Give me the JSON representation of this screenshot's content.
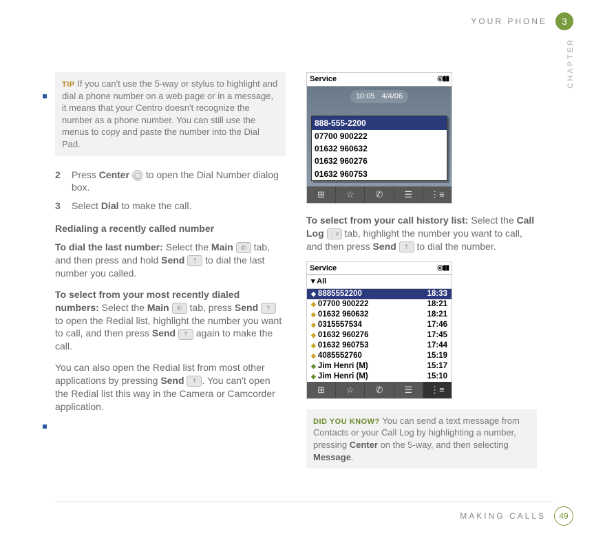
{
  "header": {
    "title": "YOUR PHONE",
    "chapter_num": "3",
    "chapter_label": "CHAPTER"
  },
  "footer": {
    "title": "MAKING CALLS",
    "page_num": "49"
  },
  "left": {
    "tip_label": "TIP",
    "tip_text": "If you can't use the 5-way or stylus to highlight and dial a phone number on a web page or in a message, it means that your Centro doesn't recognize the number as a phone number. You can still use the menus to copy and paste the number into the Dial Pad.",
    "step2_num": "2",
    "step2_a": "Press ",
    "step2_b": "Center",
    "step2_c": " to open the Dial Number dialog box.",
    "step3_num": "3",
    "step3_a": "Select ",
    "step3_b": "Dial",
    "step3_c": " to make the call.",
    "subhead_redial": "Redialing a recently called number",
    "last_a": "To dial the last number:",
    "last_b": " Select the ",
    "last_c": "Main",
    "last_d": " tab, and then press and hold ",
    "last_e": "Send",
    "last_f": " to dial the last number you called.",
    "recent_a": "To select from your most recently dialed numbers:",
    "recent_b": " Select the ",
    "recent_c": "Main",
    "recent_d": " tab, press ",
    "recent_e": "Send",
    "recent_f": " to open the Redial list, highlight the number you want to call, and then press ",
    "recent_g": "Send",
    "recent_h": " again to make the call.",
    "note_a": "You can also open the Redial list from most other applications by pressing ",
    "note_b": "Send",
    "note_c": ". You can't open the Redial list this way in the Camera or Camcorder application."
  },
  "right": {
    "shot1": {
      "service": "Service",
      "signal": "◎▮▮",
      "time": "10:05",
      "date": "4/4/06",
      "hl": "888-555-2200",
      "rows": [
        "07700 900222",
        "01632 960632",
        "01632 960276",
        "01632 960753"
      ],
      "tabs": [
        "⊞",
        "☆",
        "✆",
        "☰",
        "⋮≡"
      ]
    },
    "hist_a": "To select from your call history list:",
    "hist_b": " Select the ",
    "hist_c": "Call Log",
    "hist_d": " tab, highlight the number you want to call, and then press ",
    "hist_e": "Send",
    "hist_f": " to dial the number.",
    "shot2": {
      "service": "Service",
      "signal": "◎▮▮",
      "filter": "▾ All",
      "rows": [
        {
          "n": "8885552200",
          "t": "18:33",
          "sel": true,
          "dir": "out"
        },
        {
          "n": "07700 900222",
          "t": "18:21",
          "dir": "out"
        },
        {
          "n": "01632 960632",
          "t": "18:21",
          "dir": "out"
        },
        {
          "n": "0315557534",
          "t": "17:46",
          "dir": "out"
        },
        {
          "n": "01632 960276",
          "t": "17:45",
          "dir": "out"
        },
        {
          "n": "01632 960753",
          "t": "17:44",
          "dir": "out"
        },
        {
          "n": "4085552760",
          "t": "15:19",
          "dir": "out"
        },
        {
          "n": "Jim Henri  (M)",
          "t": "15:17",
          "dir": "in"
        },
        {
          "n": "Jim Henri  (M)",
          "t": "15:10",
          "dir": "in"
        }
      ],
      "tabs": [
        "⊞",
        "☆",
        "✆",
        "☰",
        "⋮≡"
      ]
    },
    "dyk_label": "DID YOU KNOW?",
    "dyk_a": "You can send a text message from Contacts or your Call Log by highlighting a number, pressing ",
    "dyk_b": "Center",
    "dyk_c": " on the 5-way, and then selecting ",
    "dyk_d": "Message",
    "dyk_e": "."
  }
}
